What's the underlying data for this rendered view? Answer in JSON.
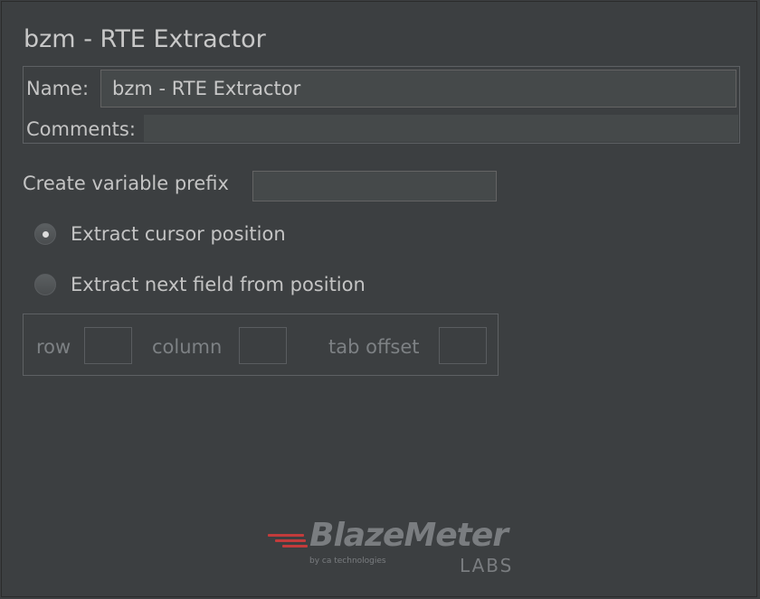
{
  "title": "bzm - RTE Extractor",
  "name_field": {
    "label": "Name:",
    "value": "bzm - RTE Extractor"
  },
  "comments_field": {
    "label": "Comments:",
    "value": ""
  },
  "variable_prefix": {
    "label": "Create variable prefix",
    "value": ""
  },
  "radio_options": [
    {
      "label": "Extract cursor position",
      "checked": true
    },
    {
      "label": "Extract next field from position",
      "checked": false
    }
  ],
  "position_fields": {
    "row_label": "row",
    "column_label": "column",
    "tab_offset_label": "tab offset",
    "row_value": "",
    "column_value": "",
    "tab_offset_value": "",
    "enabled": false
  },
  "logo": {
    "brand": "BlazeMeter",
    "by_line": "by ca technologies",
    "labs": "LABS",
    "accent_color": "#c23b3b"
  },
  "theme": {
    "background": "#3c3f41",
    "input_background": "#45494a",
    "text": "#bbbbbb"
  }
}
